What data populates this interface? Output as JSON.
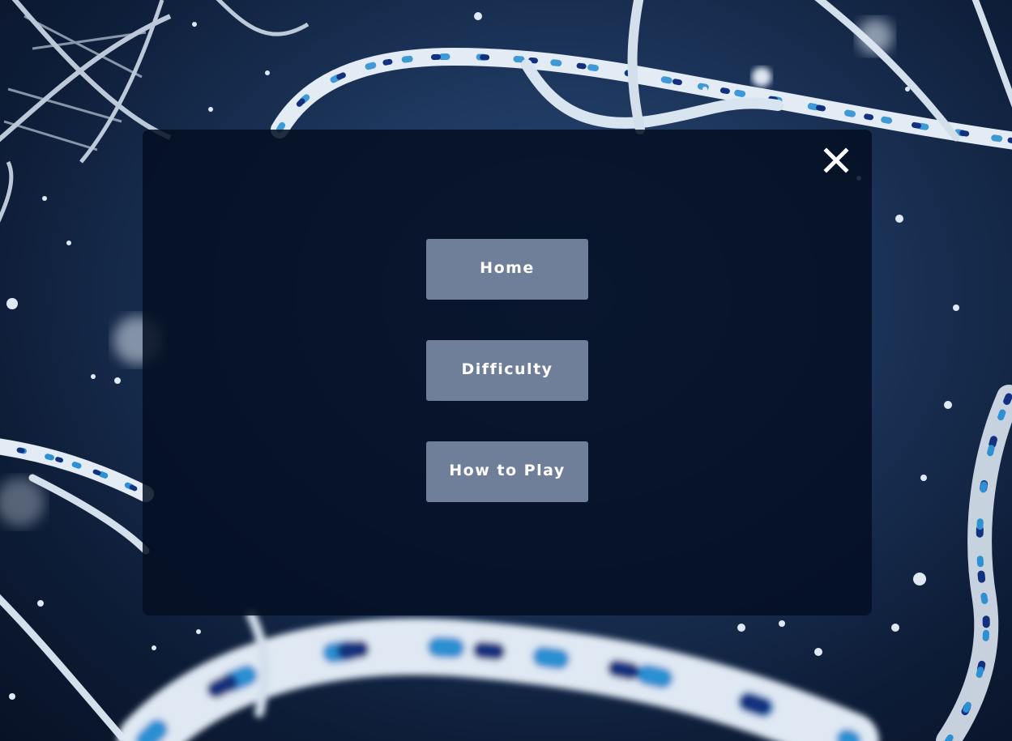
{
  "background": {
    "image": "dna-double-helix",
    "colors": {
      "deep": "#081226",
      "mid": "#1b3358",
      "light": "#2c4d7c",
      "strand_white": "#e6edf6",
      "strand_blue": "#2a8fd0",
      "strand_navy": "#0f2a7a"
    }
  },
  "menu": {
    "close_icon": "close-icon",
    "buttons": [
      {
        "label": "Home"
      },
      {
        "label": "Difficulty"
      },
      {
        "label": "How to Play"
      }
    ],
    "colors": {
      "panel": "#040e22",
      "button": "#707f99",
      "button_text": "#ffffff"
    }
  }
}
